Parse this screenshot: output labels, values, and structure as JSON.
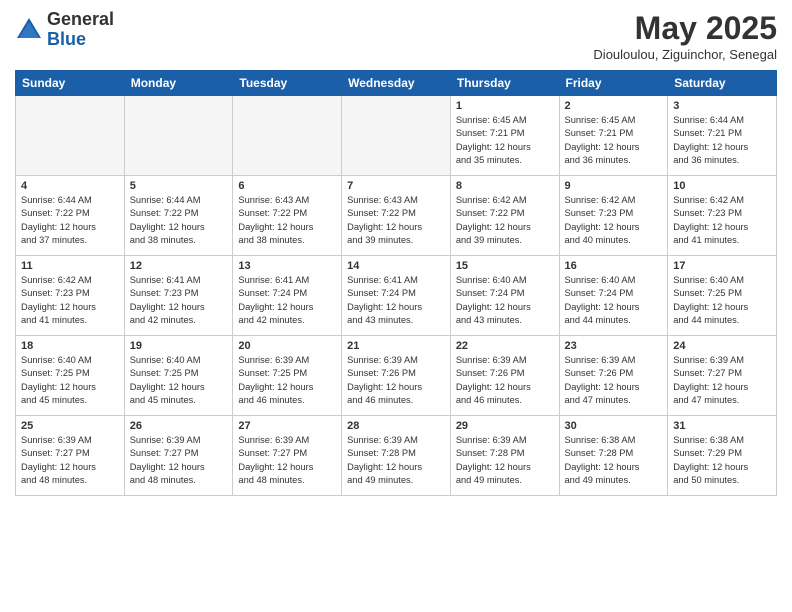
{
  "logo": {
    "general": "General",
    "blue": "Blue"
  },
  "title": "May 2025",
  "location": "Diouloulou, Ziguinchor, Senegal",
  "headers": [
    "Sunday",
    "Monday",
    "Tuesday",
    "Wednesday",
    "Thursday",
    "Friday",
    "Saturday"
  ],
  "weeks": [
    [
      {
        "day": "",
        "info": ""
      },
      {
        "day": "",
        "info": ""
      },
      {
        "day": "",
        "info": ""
      },
      {
        "day": "",
        "info": ""
      },
      {
        "day": "1",
        "info": "Sunrise: 6:45 AM\nSunset: 7:21 PM\nDaylight: 12 hours\nand 35 minutes."
      },
      {
        "day": "2",
        "info": "Sunrise: 6:45 AM\nSunset: 7:21 PM\nDaylight: 12 hours\nand 36 minutes."
      },
      {
        "day": "3",
        "info": "Sunrise: 6:44 AM\nSunset: 7:21 PM\nDaylight: 12 hours\nand 36 minutes."
      }
    ],
    [
      {
        "day": "4",
        "info": "Sunrise: 6:44 AM\nSunset: 7:22 PM\nDaylight: 12 hours\nand 37 minutes."
      },
      {
        "day": "5",
        "info": "Sunrise: 6:44 AM\nSunset: 7:22 PM\nDaylight: 12 hours\nand 38 minutes."
      },
      {
        "day": "6",
        "info": "Sunrise: 6:43 AM\nSunset: 7:22 PM\nDaylight: 12 hours\nand 38 minutes."
      },
      {
        "day": "7",
        "info": "Sunrise: 6:43 AM\nSunset: 7:22 PM\nDaylight: 12 hours\nand 39 minutes."
      },
      {
        "day": "8",
        "info": "Sunrise: 6:42 AM\nSunset: 7:22 PM\nDaylight: 12 hours\nand 39 minutes."
      },
      {
        "day": "9",
        "info": "Sunrise: 6:42 AM\nSunset: 7:23 PM\nDaylight: 12 hours\nand 40 minutes."
      },
      {
        "day": "10",
        "info": "Sunrise: 6:42 AM\nSunset: 7:23 PM\nDaylight: 12 hours\nand 41 minutes."
      }
    ],
    [
      {
        "day": "11",
        "info": "Sunrise: 6:42 AM\nSunset: 7:23 PM\nDaylight: 12 hours\nand 41 minutes."
      },
      {
        "day": "12",
        "info": "Sunrise: 6:41 AM\nSunset: 7:23 PM\nDaylight: 12 hours\nand 42 minutes."
      },
      {
        "day": "13",
        "info": "Sunrise: 6:41 AM\nSunset: 7:24 PM\nDaylight: 12 hours\nand 42 minutes."
      },
      {
        "day": "14",
        "info": "Sunrise: 6:41 AM\nSunset: 7:24 PM\nDaylight: 12 hours\nand 43 minutes."
      },
      {
        "day": "15",
        "info": "Sunrise: 6:40 AM\nSunset: 7:24 PM\nDaylight: 12 hours\nand 43 minutes."
      },
      {
        "day": "16",
        "info": "Sunrise: 6:40 AM\nSunset: 7:24 PM\nDaylight: 12 hours\nand 44 minutes."
      },
      {
        "day": "17",
        "info": "Sunrise: 6:40 AM\nSunset: 7:25 PM\nDaylight: 12 hours\nand 44 minutes."
      }
    ],
    [
      {
        "day": "18",
        "info": "Sunrise: 6:40 AM\nSunset: 7:25 PM\nDaylight: 12 hours\nand 45 minutes."
      },
      {
        "day": "19",
        "info": "Sunrise: 6:40 AM\nSunset: 7:25 PM\nDaylight: 12 hours\nand 45 minutes."
      },
      {
        "day": "20",
        "info": "Sunrise: 6:39 AM\nSunset: 7:25 PM\nDaylight: 12 hours\nand 46 minutes."
      },
      {
        "day": "21",
        "info": "Sunrise: 6:39 AM\nSunset: 7:26 PM\nDaylight: 12 hours\nand 46 minutes."
      },
      {
        "day": "22",
        "info": "Sunrise: 6:39 AM\nSunset: 7:26 PM\nDaylight: 12 hours\nand 46 minutes."
      },
      {
        "day": "23",
        "info": "Sunrise: 6:39 AM\nSunset: 7:26 PM\nDaylight: 12 hours\nand 47 minutes."
      },
      {
        "day": "24",
        "info": "Sunrise: 6:39 AM\nSunset: 7:27 PM\nDaylight: 12 hours\nand 47 minutes."
      }
    ],
    [
      {
        "day": "25",
        "info": "Sunrise: 6:39 AM\nSunset: 7:27 PM\nDaylight: 12 hours\nand 48 minutes."
      },
      {
        "day": "26",
        "info": "Sunrise: 6:39 AM\nSunset: 7:27 PM\nDaylight: 12 hours\nand 48 minutes."
      },
      {
        "day": "27",
        "info": "Sunrise: 6:39 AM\nSunset: 7:27 PM\nDaylight: 12 hours\nand 48 minutes."
      },
      {
        "day": "28",
        "info": "Sunrise: 6:39 AM\nSunset: 7:28 PM\nDaylight: 12 hours\nand 49 minutes."
      },
      {
        "day": "29",
        "info": "Sunrise: 6:39 AM\nSunset: 7:28 PM\nDaylight: 12 hours\nand 49 minutes."
      },
      {
        "day": "30",
        "info": "Sunrise: 6:38 AM\nSunset: 7:28 PM\nDaylight: 12 hours\nand 49 minutes."
      },
      {
        "day": "31",
        "info": "Sunrise: 6:38 AM\nSunset: 7:29 PM\nDaylight: 12 hours\nand 50 minutes."
      }
    ]
  ]
}
